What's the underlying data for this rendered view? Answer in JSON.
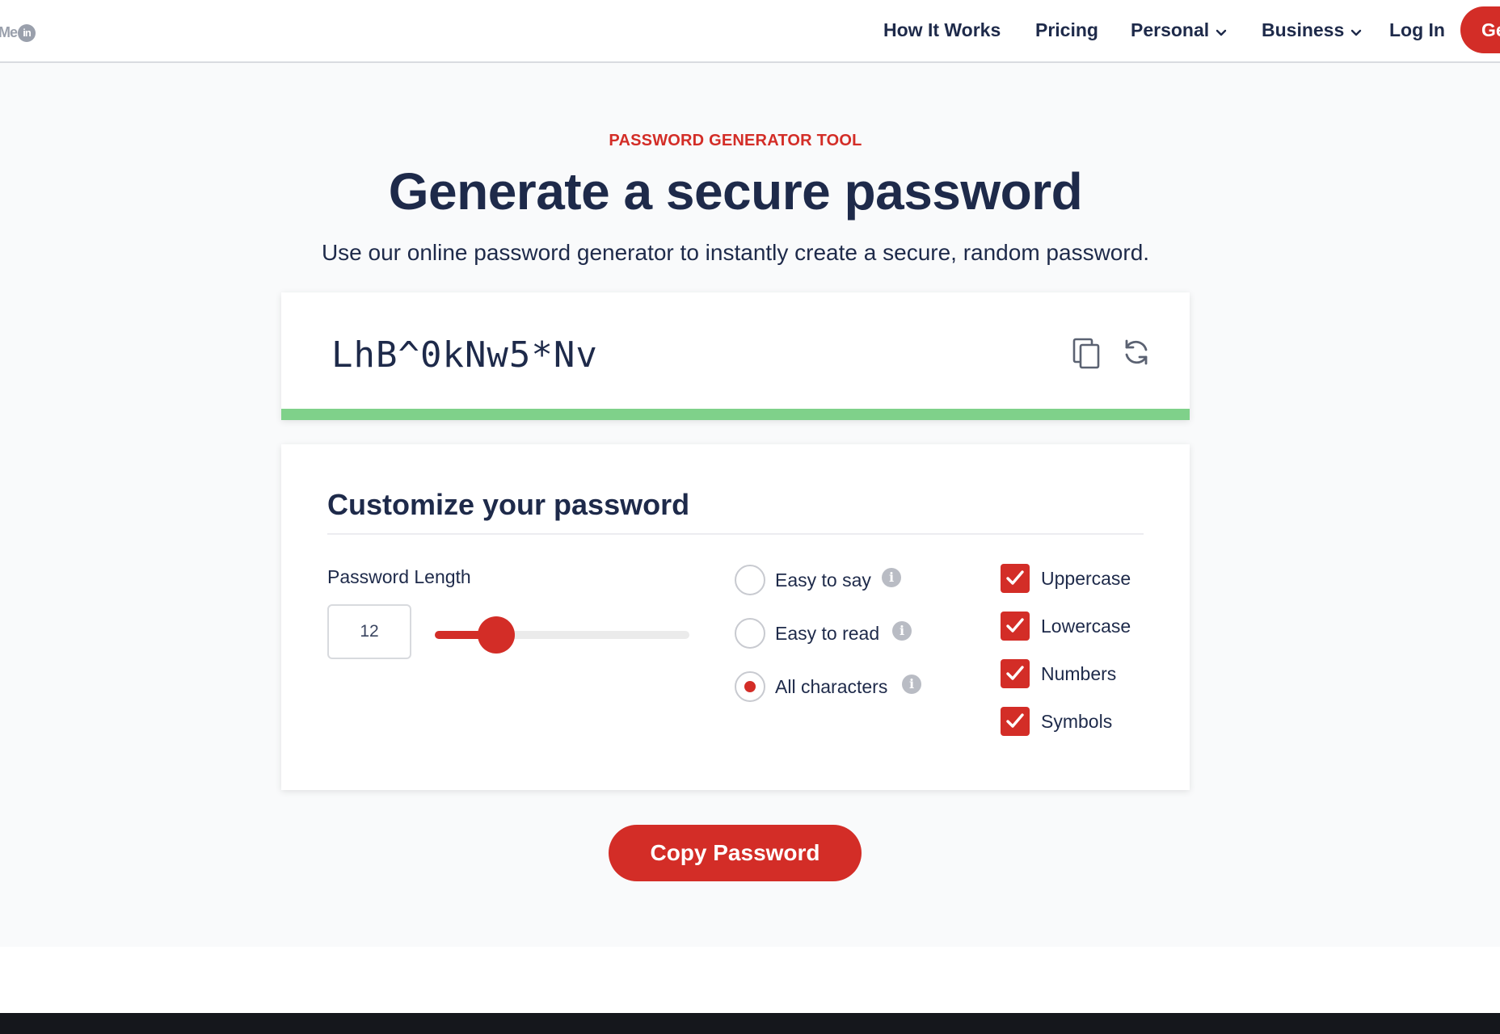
{
  "brand": {
    "logo_text": "Me",
    "logo_badge": "in"
  },
  "nav": {
    "how_it_works": "How It Works",
    "pricing": "Pricing",
    "personal": "Personal",
    "business": "Business",
    "login": "Log In",
    "cta": "Get"
  },
  "hero": {
    "eyebrow": "PASSWORD GENERATOR TOOL",
    "title": "Generate a secure password",
    "subtitle": "Use our online password generator to instantly create a secure, random password."
  },
  "generator": {
    "password": "LhB^0kNw5*Nv",
    "copy_icon": "copy-icon",
    "refresh_icon": "refresh-icon",
    "strength_color": "#7fd18a"
  },
  "customize": {
    "title": "Customize your password",
    "length_label": "Password Length",
    "length_value": "12",
    "slider_fraction": 0.24,
    "modes": [
      {
        "label": "Easy to say",
        "selected": false
      },
      {
        "label": "Easy to read",
        "selected": false
      },
      {
        "label": "All characters",
        "selected": true
      }
    ],
    "options": [
      {
        "label": "Uppercase",
        "checked": true
      },
      {
        "label": "Lowercase",
        "checked": true
      },
      {
        "label": "Numbers",
        "checked": true
      },
      {
        "label": "Symbols",
        "checked": true
      }
    ]
  },
  "actions": {
    "copy_label": "Copy Password"
  },
  "colors": {
    "accent": "#d32d27",
    "text": "#1e2a4a"
  }
}
